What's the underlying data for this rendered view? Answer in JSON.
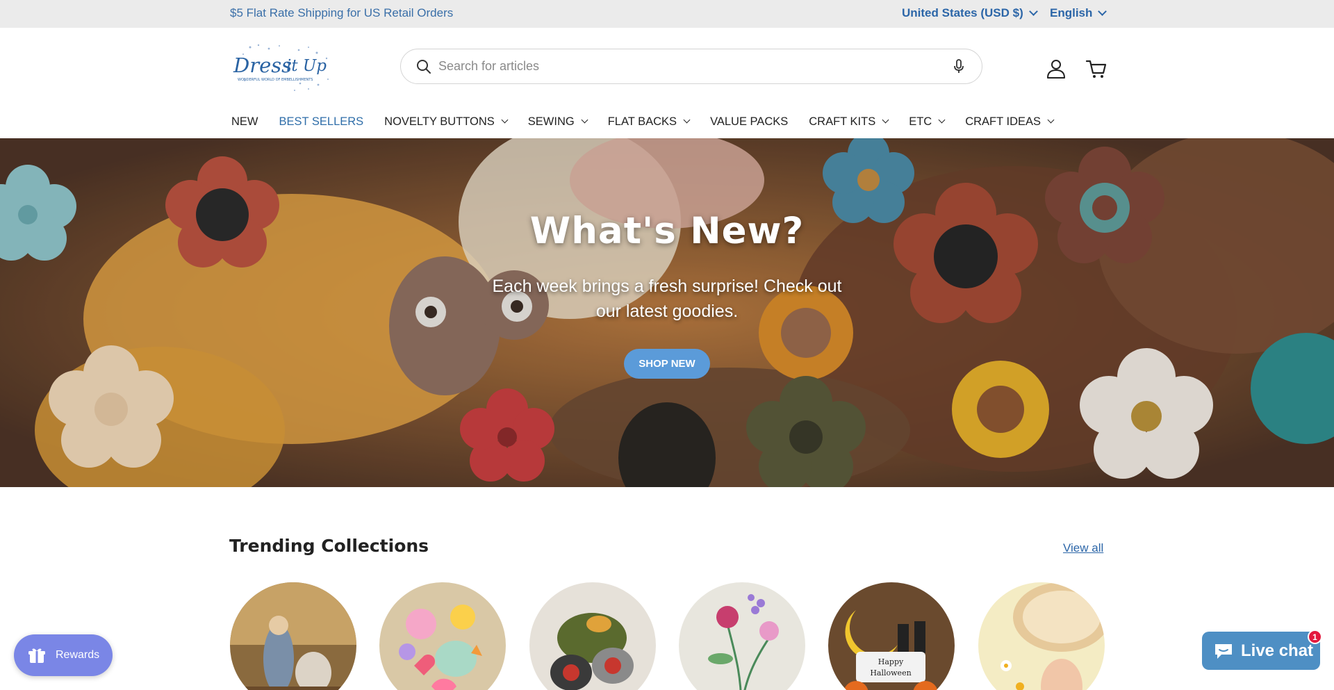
{
  "announcement": {
    "text": "$5 Flat Rate Shipping for US Retail Orders",
    "country": "United States (USD $)",
    "language": "English"
  },
  "header": {
    "logo_text": "Dress it Up",
    "logo_tagline": "WONDERFUL WORLD OF EMBELLISHMENTS",
    "search_placeholder": "Search for articles",
    "icons": [
      "search-icon",
      "microphone-icon",
      "account-icon",
      "cart-icon"
    ]
  },
  "nav": {
    "items": [
      {
        "label": "NEW",
        "dropdown": false
      },
      {
        "label": "BEST SELLERS",
        "dropdown": false,
        "active": true
      },
      {
        "label": "NOVELTY BUTTONS",
        "dropdown": true
      },
      {
        "label": "SEWING",
        "dropdown": true
      },
      {
        "label": "FLAT BACKS",
        "dropdown": true
      },
      {
        "label": "VALUE PACKS",
        "dropdown": false
      },
      {
        "label": "CRAFT KITS",
        "dropdown": true
      },
      {
        "label": "ETC",
        "dropdown": true
      },
      {
        "label": "CRAFT IDEAS",
        "dropdown": true
      }
    ]
  },
  "hero": {
    "title": "What's New?",
    "subtitle": "Each week brings a fresh surprise! Check out our latest goodies.",
    "button_label": "SHOP NEW"
  },
  "trending": {
    "title": "Trending Collections",
    "view_all": "View all",
    "collections": [
      {
        "name": "nativity-collection"
      },
      {
        "name": "kawaii-collection"
      },
      {
        "name": "ladybug-collection"
      },
      {
        "name": "embroidery-collection"
      },
      {
        "name": "halloween-collection"
      },
      {
        "name": "wood-craft-collection"
      }
    ],
    "halloween_text": "Happy Halloween"
  },
  "widgets": {
    "rewards_label": "Rewards",
    "live_chat_label": "Live chat",
    "chat_badge": "1"
  },
  "colors": {
    "accent": "#2c66a8",
    "announcement_bg": "#ebebeb",
    "hero_button": "#5b9bd9",
    "rewards_bg": "#7a86e6",
    "chat_bg": "#4e8fc4",
    "badge": "#e3193e"
  }
}
